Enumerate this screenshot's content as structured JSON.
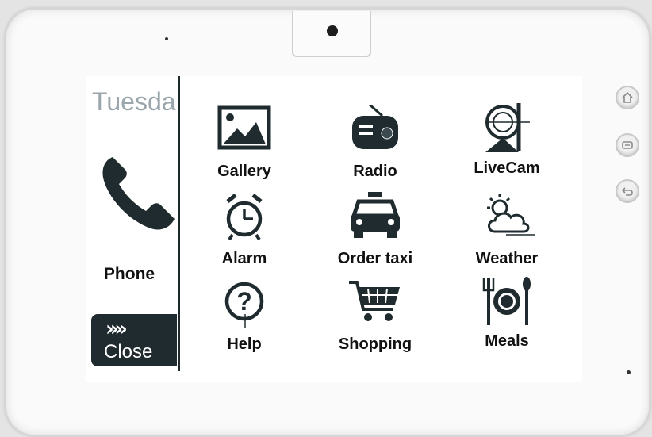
{
  "status": {
    "day": "Tuesda"
  },
  "left_panel": {
    "phone_label": "Phone",
    "close_arrows": "››››",
    "close_label": "Close"
  },
  "apps": [
    {
      "label": "Gallery",
      "icon": "image-icon"
    },
    {
      "label": "Radio",
      "icon": "radio-icon"
    },
    {
      "label": "LiveCam",
      "icon": "webcam-icon"
    },
    {
      "label": "Alarm",
      "icon": "alarm-clock-icon"
    },
    {
      "label": "Order taxi",
      "icon": "taxi-icon"
    },
    {
      "label": "Weather",
      "icon": "weather-icon"
    },
    {
      "label": "Help",
      "icon": "help-icon"
    },
    {
      "label": "Shopping",
      "icon": "shopping-cart-icon"
    },
    {
      "label": "Meals",
      "icon": "meals-icon"
    }
  ],
  "hardware_buttons": [
    "home-icon",
    "menu-icon",
    "back-icon"
  ],
  "colors": {
    "icon": "#1f2b2e",
    "day_text": "#9aa6ac",
    "close_bg": "#1f2b2e"
  }
}
